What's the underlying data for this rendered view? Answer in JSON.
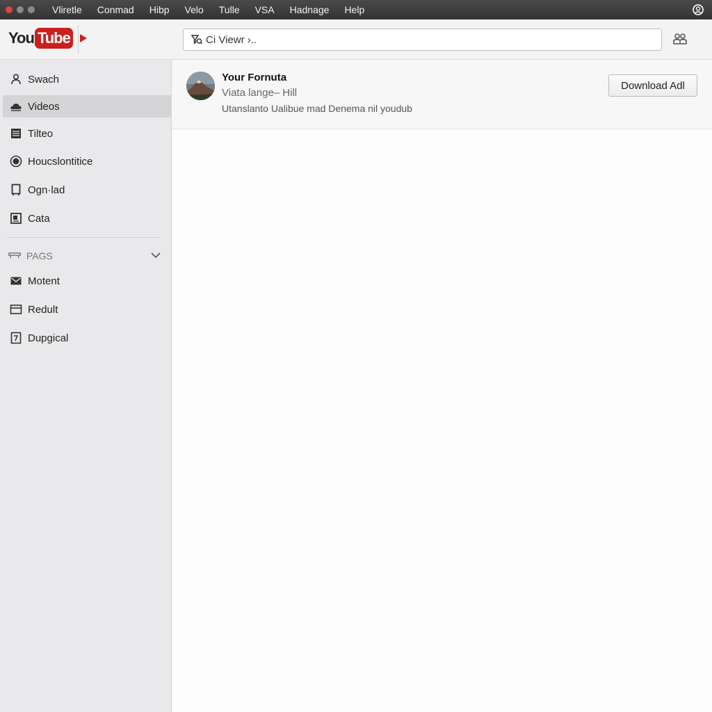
{
  "menubar": {
    "traffic_colors": [
      "#e0443e",
      "#8a8a8a",
      "#8a8a8a"
    ],
    "items": [
      "Vliretle",
      "Conmad",
      "Hibp",
      "Velo",
      "Tulle",
      "VSA",
      "Hadnage",
      "Help"
    ],
    "right_icon": "user-circle-icon"
  },
  "toolbar": {
    "logo": {
      "you": "You",
      "tube": "Tube"
    },
    "search_value": "Ci Viewr ›..",
    "search_icon": "search-funnel-icon",
    "right_icon": "people-icon"
  },
  "sidebar": {
    "items": [
      {
        "label": "Swach",
        "icon": "person-icon",
        "active": false
      },
      {
        "label": "Videos",
        "icon": "cloud-icon",
        "active": true
      },
      {
        "label": "Tilteo",
        "icon": "list-icon",
        "active": false
      },
      {
        "label": "Houcslontitice",
        "icon": "record-icon",
        "active": false
      },
      {
        "label": "Ogn·lad",
        "icon": "phone-icon",
        "active": false
      },
      {
        "label": "Cata",
        "icon": "box-icon",
        "active": false
      }
    ],
    "section_title": "PAGS",
    "section_items": [
      {
        "label": "Motent",
        "icon": "mail-icon"
      },
      {
        "label": "Redult",
        "icon": "window-icon"
      },
      {
        "label": "Dupgical",
        "icon": "document-icon"
      }
    ]
  },
  "profile": {
    "name": "Your Fornuta",
    "subtitle": "Viata lange– Hill",
    "description": "Utanslanto Ualibue mad Denema nil youdub",
    "download_label": "Download Adl"
  },
  "colors": {
    "menubar_bg": "#3a3a3a",
    "sidebar_bg": "#e9e9eb",
    "brand_red": "#cc1f1f"
  }
}
